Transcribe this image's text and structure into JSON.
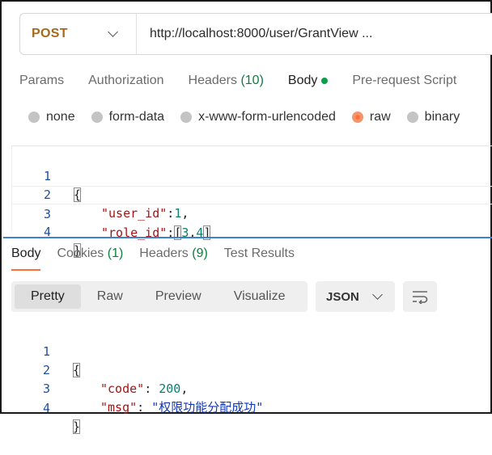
{
  "request": {
    "method": "POST",
    "url": "http://localhost:8000/user/GrantView ..."
  },
  "request_tabs": [
    {
      "label": "Params"
    },
    {
      "label": "Authorization"
    },
    {
      "label": "Headers",
      "count": "(10)"
    },
    {
      "label": "Body"
    },
    {
      "label": "Pre-request Script"
    }
  ],
  "body_types": [
    "none",
    "form-data",
    "x-www-form-urlencoded",
    "raw",
    "binary"
  ],
  "selected_body_type": "raw",
  "request_body": {
    "line_numbers": [
      "1",
      "2",
      "3",
      "4"
    ],
    "open_brace": "{",
    "close_brace": "}",
    "user_id_key": "\"user_id\"",
    "user_id_value": "1",
    "role_id_key": "\"role_id\"",
    "role_id_values": [
      "3",
      "4"
    ]
  },
  "response_tabs": [
    {
      "label": "Body"
    },
    {
      "label": "Cookies",
      "count": "(1)"
    },
    {
      "label": "Headers",
      "count": "(9)"
    },
    {
      "label": "Test Results"
    }
  ],
  "view_modes": [
    "Pretty",
    "Raw",
    "Preview",
    "Visualize"
  ],
  "format": "JSON",
  "response_body": {
    "line_numbers": [
      "1",
      "2",
      "3",
      "4"
    ],
    "open_brace": "{",
    "close_brace": "}",
    "code_key": "\"code\"",
    "code_value": "200",
    "msg_key": "\"msg\"",
    "msg_value": "\"权限功能分配成功\""
  },
  "colors": {
    "method": "#a66a1a",
    "accent": "#ff6c37",
    "count_green": "#0a7f3f",
    "splitter": "#3b82d6"
  },
  "icons": {
    "method_dropdown": "chevron-down-icon",
    "format_dropdown": "chevron-down-icon",
    "wrap": "wrap-lines-icon"
  }
}
